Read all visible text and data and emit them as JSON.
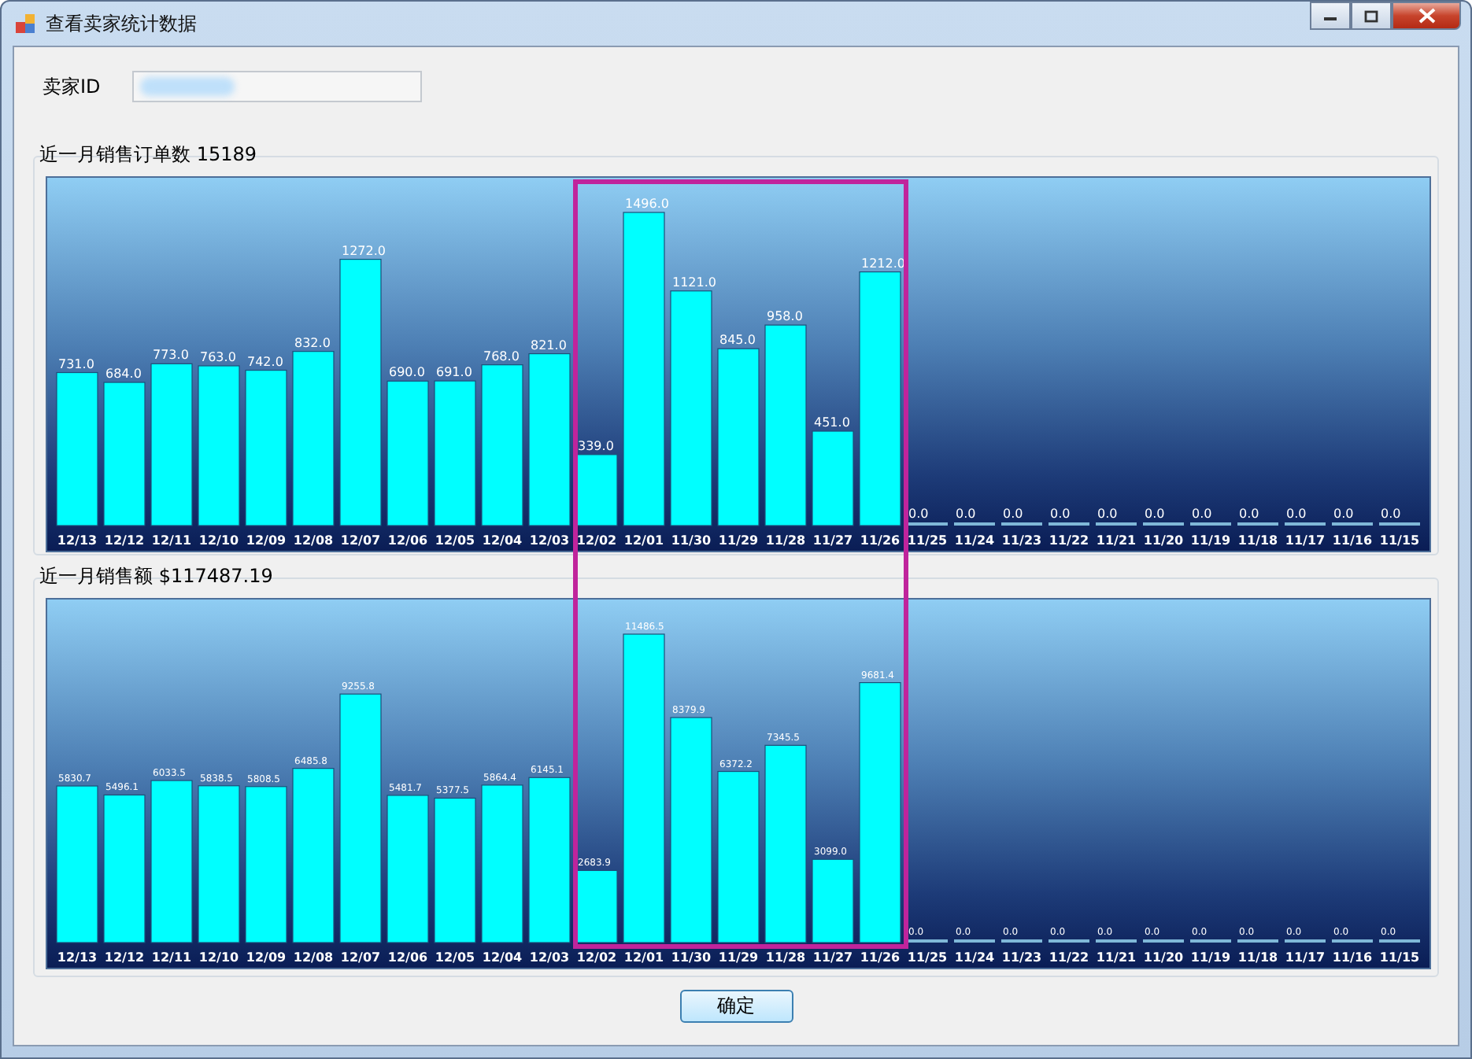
{
  "window": {
    "title": "查看卖家统计数据"
  },
  "seller_id": {
    "label": "卖家ID"
  },
  "order_count": {
    "label": "近一月销售订单数 15189",
    "chart_data": {
      "type": "bar",
      "value_labels": [
        "731.0",
        "684.0",
        "773.0",
        "763.0",
        "742.0",
        "832.0",
        "1272.0",
        "690.0",
        "691.0",
        "768.0",
        "821.0",
        "339.0",
        "1496.0",
        "1121.0",
        "845.0",
        "958.0",
        "451.0",
        "1212.0",
        "0.0",
        "0.0",
        "0.0",
        "0.0",
        "0.0",
        "0.0",
        "0.0",
        "0.0",
        "0.0",
        "0.0",
        "0.0"
      ],
      "categories": [
        "12/13",
        "12/12",
        "12/11",
        "12/10",
        "12/09",
        "12/08",
        "12/07",
        "12/06",
        "12/05",
        "12/04",
        "12/03",
        "12/02",
        "12/01",
        "11/30",
        "11/29",
        "11/28",
        "11/27",
        "11/26",
        "11/25",
        "11/24",
        "11/23",
        "11/22",
        "11/21",
        "11/20",
        "11/19",
        "11/18",
        "11/17",
        "11/16",
        "11/15"
      ],
      "values": [
        731,
        684,
        773,
        763,
        742,
        832,
        1272,
        690,
        691,
        768,
        821,
        339,
        1496,
        1121,
        845,
        958,
        451,
        1212,
        0,
        0,
        0,
        0,
        0,
        0,
        0,
        0,
        0,
        0,
        0
      ]
    }
  },
  "sales_amount": {
    "label": "近一月销售额 $117487.19",
    "chart_data": {
      "type": "bar",
      "value_labels": [
        "5830.7",
        "5496.1",
        "6033.5",
        "5838.5",
        "5808.5",
        "6485.8",
        "9255.8",
        "5481.7",
        "5377.5",
        "5864.4",
        "6145.1",
        "2683.9",
        "11486.5",
        "8379.9",
        "6372.2",
        "7345.5",
        "3099.0",
        "9681.4",
        "0.0",
        "0.0",
        "0.0",
        "0.0",
        "0.0",
        "0.0",
        "0.0",
        "0.0",
        "0.0",
        "0.0",
        "0.0"
      ],
      "categories": [
        "12/13",
        "12/12",
        "12/11",
        "12/10",
        "12/09",
        "12/08",
        "12/07",
        "12/06",
        "12/05",
        "12/04",
        "12/03",
        "12/02",
        "12/01",
        "11/30",
        "11/29",
        "11/28",
        "11/27",
        "11/26",
        "11/25",
        "11/24",
        "11/23",
        "11/22",
        "11/21",
        "11/20",
        "11/19",
        "11/18",
        "11/17",
        "11/16",
        "11/15"
      ],
      "values": [
        5830.7,
        5496.1,
        6033.5,
        5838.5,
        5808.5,
        6485.8,
        9255.8,
        5481.7,
        5377.5,
        5864.4,
        6145.1,
        2683.9,
        11486.5,
        8379.9,
        6372.2,
        7345.5,
        3099.0,
        9681.4,
        0,
        0,
        0,
        0,
        0,
        0,
        0,
        0,
        0,
        0,
        0
      ]
    }
  },
  "buttons": [
    {
      "label": "确定"
    }
  ]
}
